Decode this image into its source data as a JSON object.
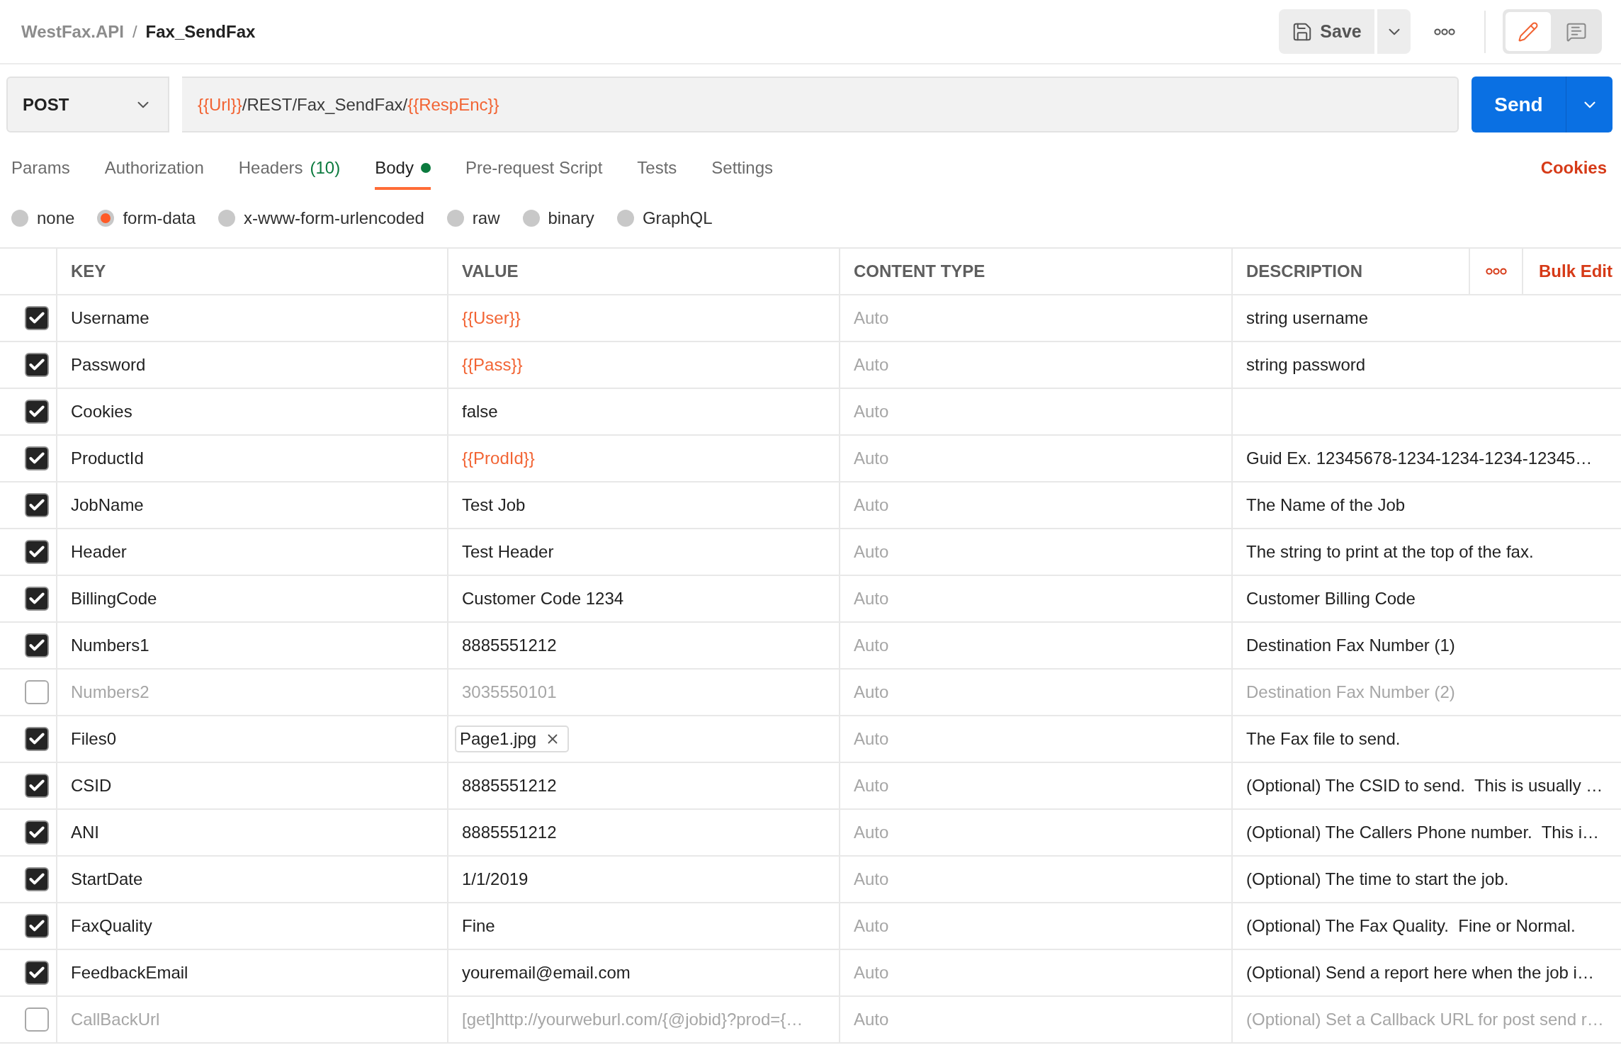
{
  "breadcrumb": {
    "collection": "WestFax.API",
    "separator": "/",
    "request": "Fax_SendFax"
  },
  "toolbar": {
    "save_label": "Save",
    "view_modes": [
      {
        "kind": "edit",
        "selected": true
      },
      {
        "kind": "comments",
        "selected": false
      }
    ]
  },
  "request": {
    "method": "POST",
    "url_segments": [
      {
        "kind": "variable",
        "text": "{{Url}}"
      },
      {
        "kind": "text",
        "text": "/REST/Fax_SendFax/"
      },
      {
        "kind": "variable",
        "text": "{{RespEnc}}"
      }
    ],
    "send_label": "Send"
  },
  "tabs": [
    {
      "label": "Params",
      "selected": false,
      "has_content": false
    },
    {
      "label": "Authorization",
      "selected": false,
      "has_content": false
    },
    {
      "label": "Headers",
      "count": "(10)",
      "selected": false,
      "has_content": false
    },
    {
      "label": "Body",
      "selected": true,
      "has_content": true
    },
    {
      "label": "Pre-request Script",
      "selected": false,
      "has_content": false
    },
    {
      "label": "Tests",
      "selected": false,
      "has_content": false
    },
    {
      "label": "Settings",
      "selected": false,
      "has_content": false
    }
  ],
  "cookies_link": "Cookies",
  "body_types": [
    {
      "label": "none",
      "selected": false
    },
    {
      "label": "form-data",
      "selected": true
    },
    {
      "label": "x-www-form-urlencoded",
      "selected": false
    },
    {
      "label": "raw",
      "selected": false
    },
    {
      "label": "binary",
      "selected": false
    },
    {
      "label": "GraphQL",
      "selected": false
    }
  ],
  "table": {
    "columns": [
      "KEY",
      "VALUE",
      "CONTENT TYPE",
      "DESCRIPTION"
    ],
    "bulk_edit": "Bulk Edit",
    "rows": [
      {
        "checked": true,
        "key": "Username",
        "value": {
          "kind": "variable",
          "text": "{{User}}"
        },
        "content_type": "Auto",
        "description": "string username"
      },
      {
        "checked": true,
        "key": "Password",
        "value": {
          "kind": "variable",
          "text": "{{Pass}}"
        },
        "content_type": "Auto",
        "description": "string password"
      },
      {
        "checked": true,
        "key": "Cookies",
        "value": {
          "kind": "text",
          "text": "false"
        },
        "content_type": "Auto"
      },
      {
        "checked": true,
        "key": "ProductId",
        "value": {
          "kind": "variable",
          "text": "{{ProdId}}"
        },
        "content_type": "Auto",
        "description": "Guid Ex. 12345678-1234-1234-1234-12345…"
      },
      {
        "checked": true,
        "key": "JobName",
        "value": {
          "kind": "text",
          "text": "Test Job"
        },
        "content_type": "Auto",
        "description": "The Name of the Job"
      },
      {
        "checked": true,
        "key": "Header",
        "value": {
          "kind": "text",
          "text": "Test Header"
        },
        "content_type": "Auto",
        "description": "The string to print at the top of the fax."
      },
      {
        "checked": true,
        "key": "BillingCode",
        "value": {
          "kind": "text",
          "text": "Customer Code 1234"
        },
        "content_type": "Auto",
        "description": "Customer Billing Code"
      },
      {
        "checked": true,
        "key": "Numbers1",
        "value": {
          "kind": "text",
          "text": "8885551212"
        },
        "content_type": "Auto",
        "description": "Destination Fax Number (1)"
      },
      {
        "checked": false,
        "key": "Numbers2",
        "value": {
          "kind": "text",
          "text": "3035550101"
        },
        "content_type": "Auto",
        "description": "Destination Fax Number (2)"
      },
      {
        "checked": true,
        "key": "Files0",
        "value": {
          "kind": "file",
          "text": "Page1.jpg"
        },
        "content_type": "Auto",
        "description": "The Fax file to send."
      },
      {
        "checked": true,
        "key": "CSID",
        "value": {
          "kind": "text",
          "text": "8885551212"
        },
        "content_type": "Auto",
        "description": "(Optional) The CSID to send.  This is usually …"
      },
      {
        "checked": true,
        "key": "ANI",
        "value": {
          "kind": "text",
          "text": "8885551212"
        },
        "content_type": "Auto",
        "description": "(Optional) The Callers Phone number.  This i…"
      },
      {
        "checked": true,
        "key": "StartDate",
        "value": {
          "kind": "text",
          "text": "1/1/2019"
        },
        "content_type": "Auto",
        "description": "(Optional) The time to start the job."
      },
      {
        "checked": true,
        "key": "FaxQuality",
        "value": {
          "kind": "text",
          "text": "Fine"
        },
        "content_type": "Auto",
        "description": "(Optional) The Fax Quality.  Fine or Normal."
      },
      {
        "checked": true,
        "key": "FeedbackEmail",
        "value": {
          "kind": "text",
          "text": "youremail@email.com"
        },
        "content_type": "Auto",
        "description": "(Optional) Send a report here when the job i…"
      },
      {
        "checked": false,
        "key": "CallBackUrl",
        "value": {
          "kind": "text",
          "text": "[get]http://yourweburl.com/{@jobid}?prod={…"
        },
        "content_type": "Auto",
        "description": "(Optional) Set a Callback URL for post send r…"
      }
    ]
  }
}
